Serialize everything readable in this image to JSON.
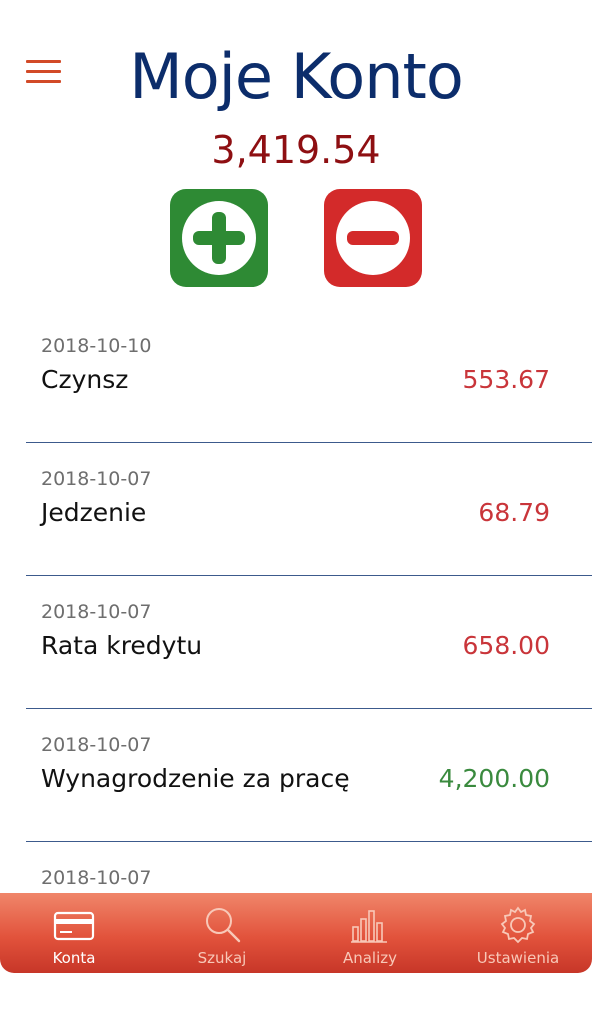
{
  "header": {
    "title": "Moje Konto",
    "balance": "3,419.54"
  },
  "actions": {
    "add_icon": "plus-circle-icon",
    "subtract_icon": "minus-circle-icon"
  },
  "transactions": [
    {
      "date": "2018-10-10",
      "name": "Czynsz",
      "amount": "553.67",
      "type": "expense"
    },
    {
      "date": "2018-10-07",
      "name": "Jedzenie",
      "amount": "68.79",
      "type": "expense"
    },
    {
      "date": "2018-10-07",
      "name": "Rata kredytu",
      "amount": "658.00",
      "type": "expense"
    },
    {
      "date": "2018-10-07",
      "name": "Wynagrodzenie za pracę",
      "amount": "4,200.00",
      "type": "income"
    },
    {
      "date": "2018-10-07",
      "name": "",
      "amount": "",
      "type": ""
    }
  ],
  "tabbar": {
    "tabs": [
      {
        "label": "Konta",
        "icon": "card-icon",
        "active": true
      },
      {
        "label": "Szukaj",
        "icon": "search-icon",
        "active": false
      },
      {
        "label": "Analizy",
        "icon": "bar-chart-icon",
        "active": false
      },
      {
        "label": "Ustawienia",
        "icon": "gear-icon",
        "active": false
      }
    ]
  },
  "colors": {
    "title": "#0c2d6b",
    "balance": "#8e0f12",
    "add": "#2e8a34",
    "subtract": "#d32a2a",
    "expense": "#c9353a",
    "income": "#3a8a3e",
    "tabbar": "#e2533c"
  }
}
